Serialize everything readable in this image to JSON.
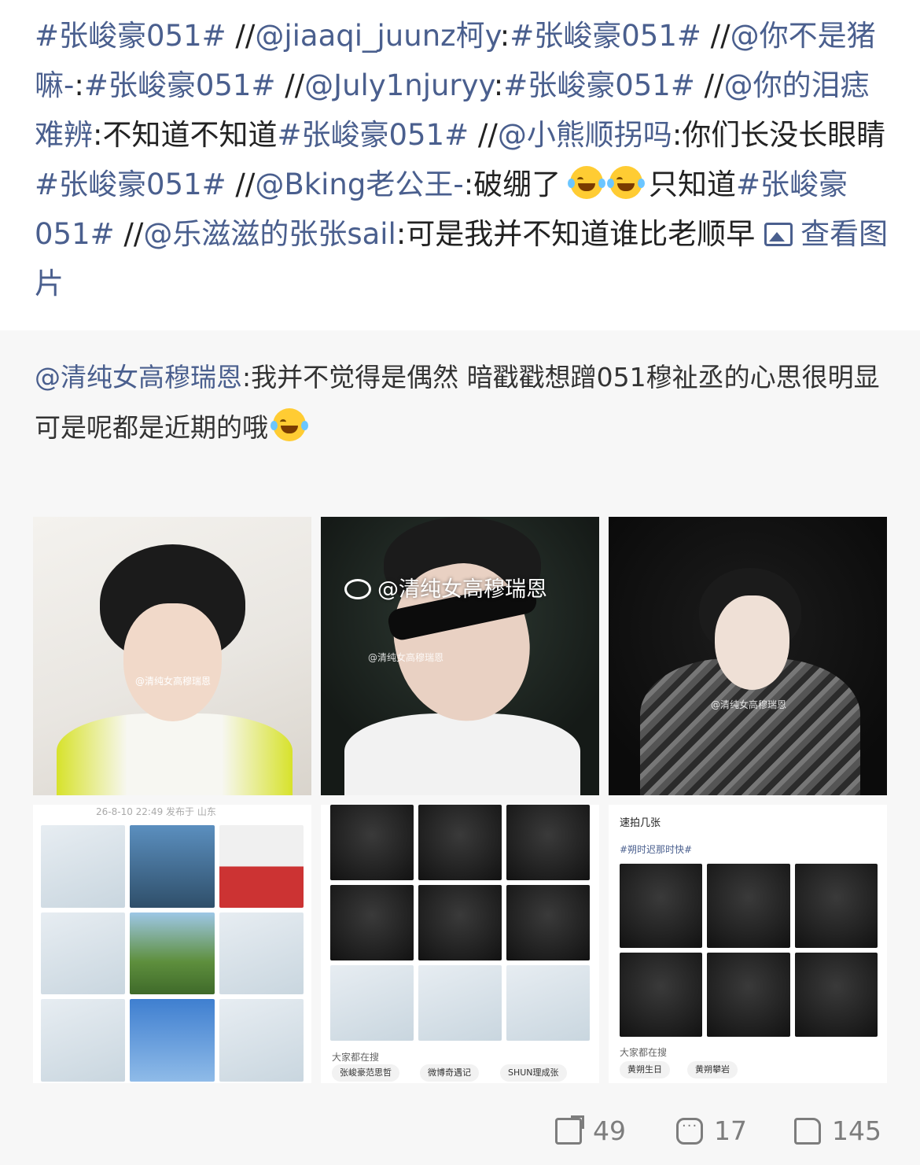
{
  "post": {
    "seg1": "#张峻豪051#",
    "seg2": " //",
    "seg3": "@jiaaqi_juunz柯y",
    "seg4": ":",
    "seg5": "#张峻豪051#",
    "seg6": " //",
    "seg7": "@你不是猪嘛-",
    "seg8": ":",
    "seg9": "#张峻豪051#",
    "seg10": " //",
    "seg11": "@July1njuryy",
    "seg12": ":",
    "seg13": "#张峻豪051#",
    "seg14": " //",
    "seg15": "@你的泪痣难辨",
    "seg16": ":不知道不知道",
    "seg17": "#张峻豪051#",
    "seg18": " //",
    "seg19": "@小熊顺拐吗",
    "seg20": ":你们长没长眼睛",
    "seg21": "#张峻豪051#",
    "seg22": " //",
    "seg23": "@Bking老公王-",
    "seg24": ":破绷了",
    "seg25": "只知道",
    "seg26": "#张峻豪051#",
    "seg27": " //",
    "seg28": "@乐滋滋的张张sail",
    "seg29": ":可是我并不知道谁比老顺早 ",
    "view_images": "查看图片"
  },
  "repost": {
    "author": "@清纯女高穆瑞恩",
    "line1": ":我并不觉得是偶然 暗戳戳想蹭051穆祉丞的心思很明显",
    "line2": "可是呢都是近期的哦"
  },
  "images": {
    "watermark_large": "@清纯女高穆瑞恩",
    "watermark_small": "@清纯女高穆瑞恩",
    "tile4_header": "26-8-10 22:49  发布于 山东",
    "tile5_search_label": "大家都在搜",
    "tile5_chips": [
      "张峻豪范思哲",
      "微博奇遇记",
      "SHUN理成张"
    ],
    "tile6_title": "速拍几张",
    "tile6_tag": "#朔时迟那时快#",
    "tile6_search_label": "大家都在搜",
    "tile6_chips": [
      "黄朔生日",
      "黄朔攀岩"
    ]
  },
  "actions": {
    "share_count": "49",
    "comment_count": "17",
    "like_count": "145"
  },
  "colors": {
    "link": "#4a5f8e",
    "text": "#222222",
    "repost_bg": "#f7f7f7",
    "action": "#7d7d7d"
  },
  "icons": [
    "laughing-crying-emoji",
    "image-icon",
    "share-icon",
    "comment-icon",
    "like-icon",
    "weibo-logo-icon"
  ]
}
